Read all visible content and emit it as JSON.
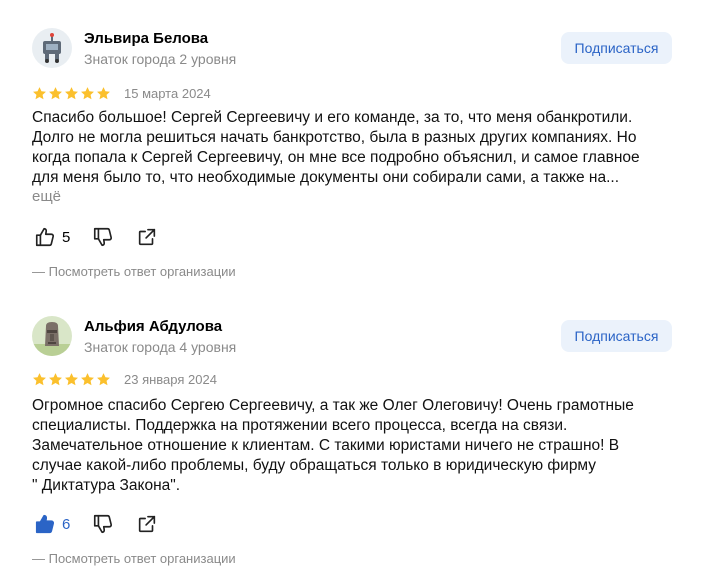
{
  "reviews": [
    {
      "name": "Эльвира Белова",
      "level": "Знаток города 2 уровня",
      "subscribe_label": "Подписаться",
      "rating": 5,
      "date": "15 марта 2024",
      "text_lines": [
        "Спасибо большое! Сергей Сергеевичу и его команде, за то, что меня обанкротили.",
        "Долго не могла решиться начать банкротство, была в разных других компаниях. Но",
        "когда попала к Сергей Сергеевичу, он мне все подробно объяснил, и самое главное",
        "для меня было то, что необходимые документы они собирали сами, а также на..."
      ],
      "more_label": "ещё",
      "likes": "5",
      "like_active": false,
      "reply_label": "— Посмотреть ответ организации"
    },
    {
      "name": "Альфия Абдулова",
      "level": "Знаток города 4 уровня",
      "subscribe_label": "Подписаться",
      "rating": 5,
      "date": "23 января 2024",
      "text_lines": [
        "Огромное спасибо Сергею Сергеевичу, а так же Олег Олеговичу! Очень грамотные",
        "специалисты. Поддержка на протяжении всего процесса, всегда на связи.",
        "Замечательное отношение к клиентам. С такими юристами ничего не страшно! В",
        "случае какой-либо проблемы, буду обращаться только в юридическую фирму",
        "\" Диктатура Закона\"."
      ],
      "likes": "6",
      "like_active": true,
      "reply_label": "— Посмотреть ответ организации"
    }
  ],
  "colors": {
    "star": "#fbc02d",
    "accent_blue": "#2b64c6",
    "secondary_text": "#8a8a8a",
    "button_bg": "#ebf2fb"
  },
  "icons": [
    "avatar-robot-icon",
    "avatar-moai-icon",
    "star-icon",
    "thumbs-up-icon",
    "thumbs-down-icon",
    "share-icon"
  ]
}
